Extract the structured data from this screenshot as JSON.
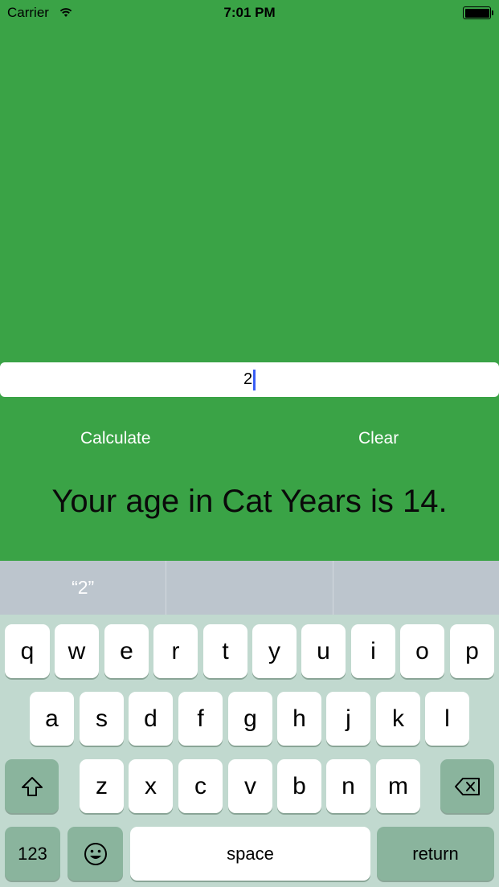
{
  "status": {
    "carrier": "Carrier",
    "time": "7:01 PM"
  },
  "age_input": {
    "value": "2"
  },
  "buttons": {
    "calculate": "Calculate",
    "clear": "Clear"
  },
  "result": "Your age in Cat Years is 14.",
  "suggestions": [
    "“2”",
    "",
    ""
  ],
  "keyboard": {
    "row1": [
      "q",
      "w",
      "e",
      "r",
      "t",
      "y",
      "u",
      "i",
      "o",
      "p"
    ],
    "row2": [
      "a",
      "s",
      "d",
      "f",
      "g",
      "h",
      "j",
      "k",
      "l"
    ],
    "row3": [
      "z",
      "x",
      "c",
      "v",
      "b",
      "n",
      "m"
    ],
    "numbers_label": "123",
    "space_label": "space",
    "return_label": "return"
  },
  "colors": {
    "background": "#3aa346",
    "keyboard": "#c1d9cf",
    "caret": "#3a5ef5"
  }
}
